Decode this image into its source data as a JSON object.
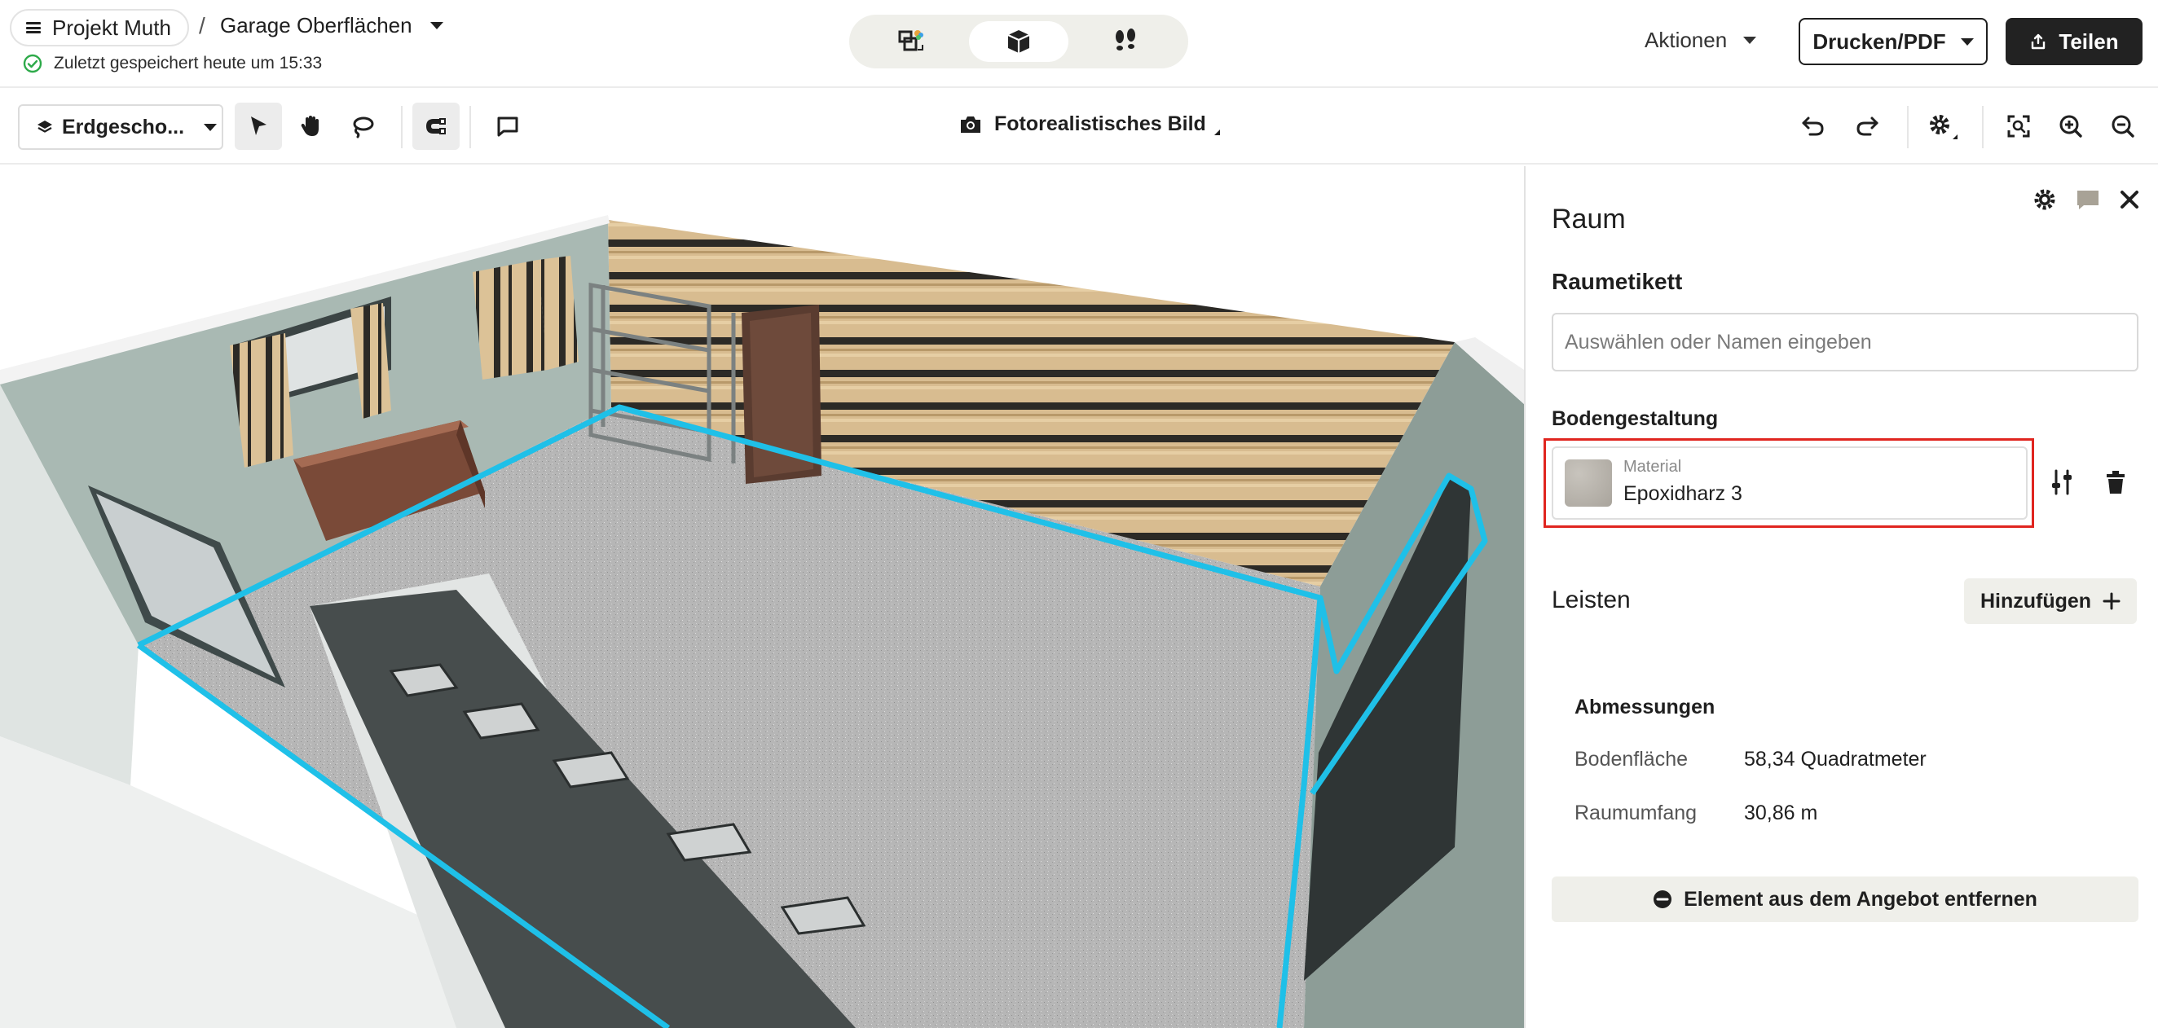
{
  "header": {
    "project_name": "Projekt Muth",
    "separator": "/",
    "room_name": "Garage Oberflächen",
    "saved_status": "Zuletzt gespeichert heute um 15:33",
    "view_modes": [
      "2D-Grundriss",
      "3D-Ansicht",
      "Begehung"
    ],
    "active_view_mode": "3D-Ansicht",
    "actions_label": "Aktionen",
    "print_label": "Drucken/PDF",
    "share_label": "Teilen"
  },
  "toolbar": {
    "floor_label": "Erdgescho...",
    "photo_label": "Fotorealistisches Bild"
  },
  "icons": {
    "hamburger": "menu-icon",
    "saved": "check-circle-icon",
    "view_2d": "floorplan-icon",
    "view_3d": "cube-icon",
    "view_walk": "footsteps-icon",
    "share": "share-icon",
    "layers": "layers-icon",
    "select": "cursor-arrow-icon",
    "pan": "hand-icon",
    "lasso": "lasso-icon",
    "magnet": "magnet-icon",
    "comment": "comment-icon",
    "camera": "camera-icon",
    "undo": "undo-icon",
    "redo": "redo-icon",
    "settings": "gear-icon",
    "focus": "focus-frame-icon",
    "zoom_in": "zoom-in-icon",
    "zoom_out": "zoom-out-icon"
  },
  "panel": {
    "title": "Raum",
    "room_label_title": "Raumetikett",
    "room_label_placeholder": "Auswählen oder Namen eingeben",
    "floor_design_title": "Bodengestaltung",
    "material_caption": "Material",
    "material_name": "Epoxidharz 3",
    "baseboards_title": "Leisten",
    "add_label": "Hinzufügen",
    "dimensions": {
      "title": "Abmessungen",
      "rows": [
        {
          "label": "Bodenfläche",
          "value": "58,34 Quadratmeter"
        },
        {
          "label": "Raumumfang",
          "value": "30,86 m"
        }
      ]
    },
    "remove_label": "Element aus dem Angebot entfernen"
  },
  "colors": {
    "selection_outline": "#1fc0e8",
    "highlight_border": "#e0251f",
    "primary_dark": "#222222",
    "wall_color": "#a9b9b3",
    "floor_color": "#b3b3b3"
  }
}
